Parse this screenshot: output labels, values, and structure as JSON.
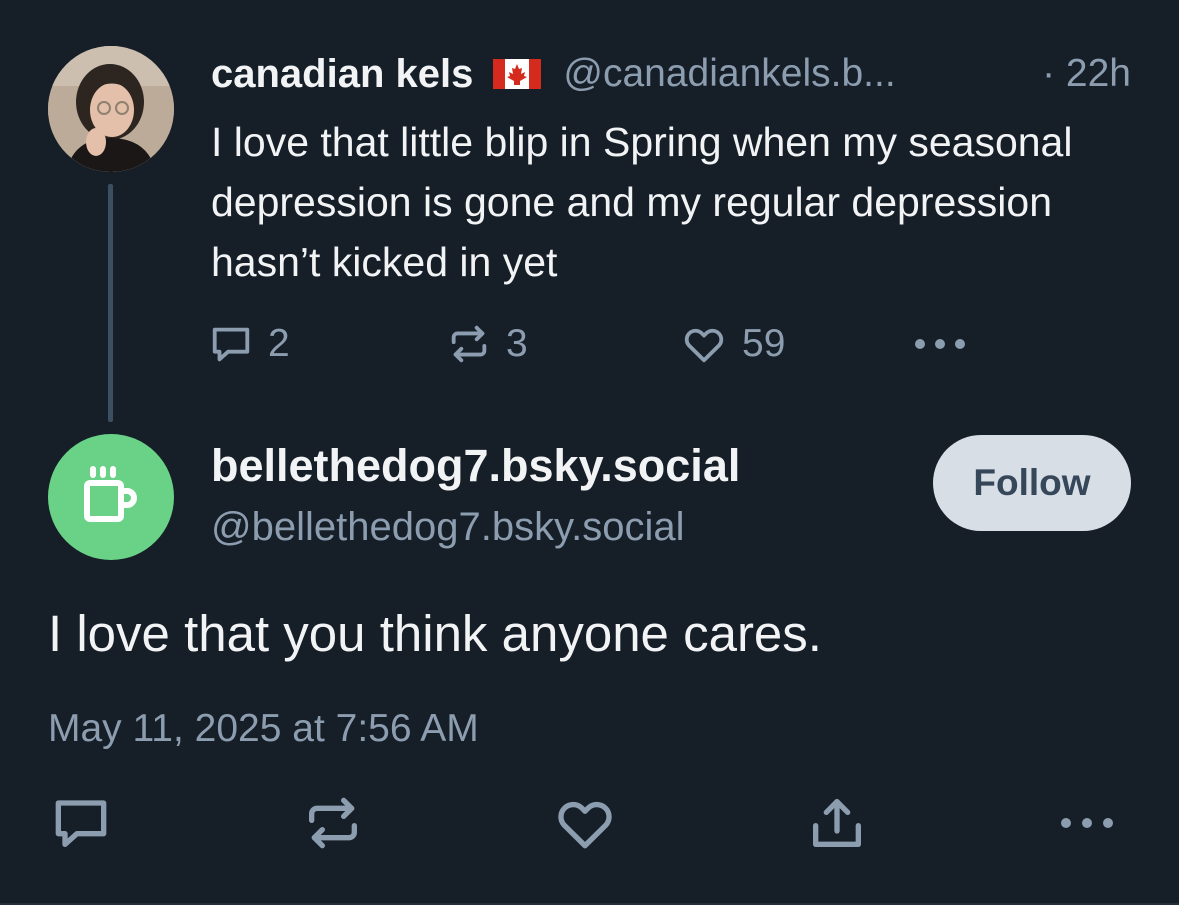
{
  "parent_post": {
    "author_name": "canadian kels",
    "author_handle": "@canadiankels.b...",
    "age": "· 22h",
    "text": "I love that little blip in Spring when my seasonal depression is gone and my regular depression hasn’t kicked in yet",
    "reply_count": "2",
    "repost_count": "3",
    "like_count": "59"
  },
  "main_post": {
    "author_name": "bellethedog7.bsky.social",
    "author_handle": "@bellethedog7.bsky.social",
    "follow_label": "Follow",
    "text": "I love that you think anyone cares.",
    "timestamp": "May 11, 2025 at 7:56 AM"
  },
  "colors": {
    "background": "#161e27",
    "primary_text": "#f1f3f5",
    "secondary_text": "#8c9db0",
    "follow_button_bg": "#d8dee6",
    "default_avatar_bg": "#69d286"
  },
  "icons": {
    "flag": "canada-flag-icon",
    "reply": "speech-bubble-icon",
    "repost": "repost-arrows-icon",
    "like": "heart-icon",
    "share": "share-upload-icon",
    "more": "ellipsis-icon",
    "default_avatar": "coffee-mug-icon"
  }
}
